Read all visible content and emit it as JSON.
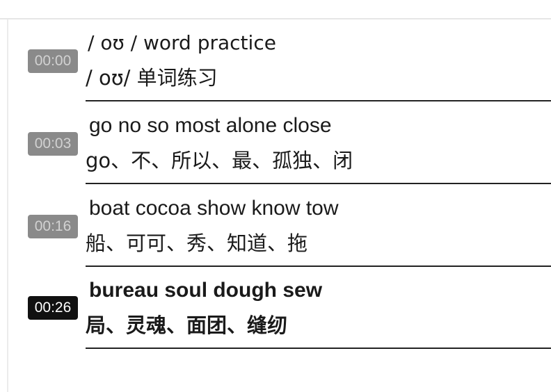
{
  "entries": [
    {
      "time": "00:00",
      "english": "/ oʊ / word practice",
      "chinese": "/ oʊ/ 单词练习",
      "active": false
    },
    {
      "time": "00:03",
      "english": "go no so most alone close",
      "chinese": "go、不、所以、最、孤独、闭",
      "active": false
    },
    {
      "time": "00:16",
      "english": "boat cocoa show know tow",
      "chinese": "船、可可、秀、知道、拖",
      "active": false
    },
    {
      "time": "00:26",
      "english": "bureau soul dough sew",
      "chinese": "局、灵魂、面团、缝纫",
      "active": true
    }
  ],
  "colors": {
    "timestamp_inactive_bg": "#8a8a8a",
    "timestamp_active_bg": "#111111",
    "divider": "#222222"
  }
}
